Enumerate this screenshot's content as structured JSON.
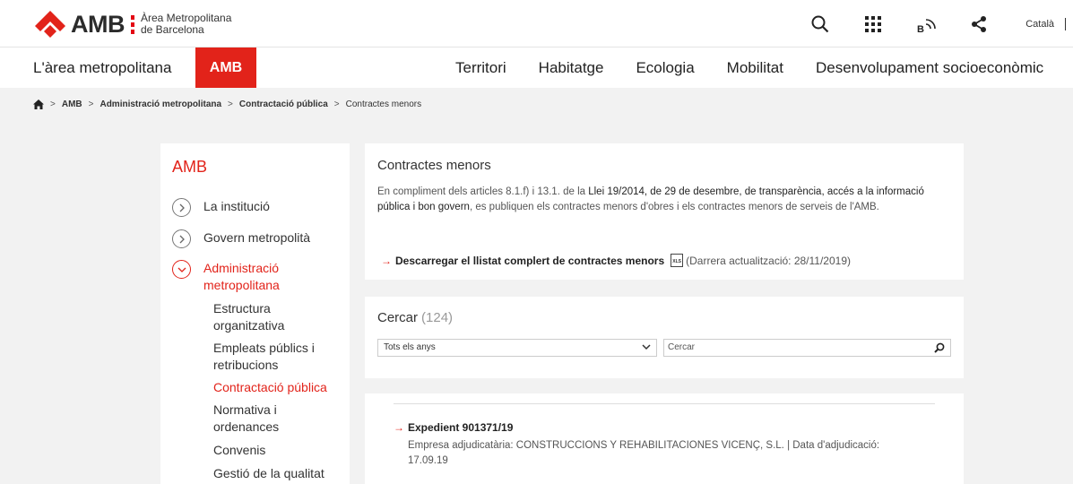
{
  "header": {
    "logo_text": "AMB",
    "logo_sub_line1": "Àrea Metropolitana",
    "logo_sub_line2": "de Barcelona",
    "language": "Català",
    "icons": [
      "search-icon",
      "apps-grid-icon",
      "blog-icon",
      "share-icon"
    ]
  },
  "nav": {
    "left_label": "L'àrea metropolitana",
    "amb_label": "AMB",
    "items": [
      "Territori",
      "Habitatge",
      "Ecologia",
      "Mobilitat",
      "Desenvolupament socioeconòmic"
    ]
  },
  "breadcrumb": {
    "items": [
      "AMB",
      "Administració metropolitana",
      "Contractació pública",
      "Contractes menors"
    ]
  },
  "sidebar": {
    "title": "AMB",
    "items": [
      {
        "label": "La institució"
      },
      {
        "label": "Govern metropolità"
      },
      {
        "label": "Administració metropolitana"
      }
    ],
    "subitems": [
      {
        "label": "Estructura organitzativa"
      },
      {
        "label": "Empleats públics i retribucions"
      },
      {
        "label": "Contractació pública"
      },
      {
        "label": "Normativa i ordenances"
      },
      {
        "label": "Convenis"
      },
      {
        "label": "Gestió de la qualitat"
      }
    ]
  },
  "intro": {
    "title": "Contractes menors",
    "text_part1": "En compliment dels articles 8.1.f) i 13.1. de la ",
    "law_link": "Llei 19/2014, de 29 de desembre, de transparència, accés a la informació pública i bon govern",
    "text_part2": ", es publiquen els contractes menors d'obres i els contractes menors de serveis de l'AMB.",
    "download_label": "Descarregar el llistat complert de contractes menors",
    "file_label": "XLS",
    "update_note": "(Darrera actualització: 28/11/2019)"
  },
  "search": {
    "title": "Cercar",
    "count": "(124)",
    "year_select": "Tots els anys",
    "placeholder": "Cercar"
  },
  "results": [
    {
      "title": "Expedient 901371/19",
      "meta": "Empresa adjudicatària: CONSTRUCCIONS Y REHABILITACIONES VICENÇ, S.L. | Data d'adjudicació: 17.09.19"
    }
  ],
  "colors": {
    "accent": "#e2231a",
    "background": "#f2f2f2"
  }
}
